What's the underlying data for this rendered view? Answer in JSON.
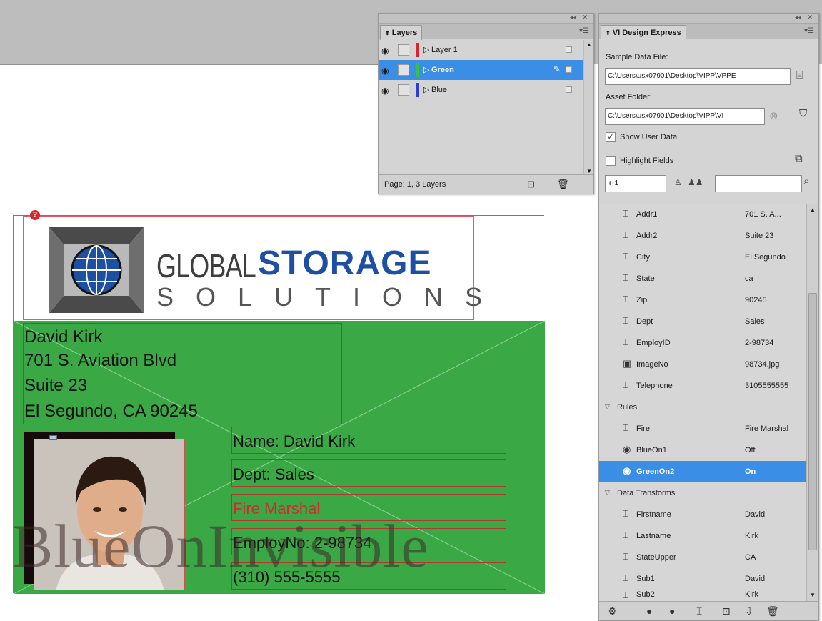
{
  "layers_panel": {
    "tab_label": "Layers",
    "layers": [
      {
        "name": "Layer 1",
        "color": "#d8262e",
        "selected": false
      },
      {
        "name": "Green",
        "color": "#35c24a",
        "selected": true
      },
      {
        "name": "Blue",
        "color": "#2b3fd6",
        "selected": false
      }
    ],
    "status": "Page: 1, 3 Layers"
  },
  "vi_panel": {
    "tab_label": "VI Design Express",
    "sample_data_label": "Sample Data File:",
    "sample_data_value": "C:\\Users\\usx07901\\Desktop\\VIPP\\VPPE",
    "asset_folder_label": "Asset Folder:",
    "asset_folder_value": "C:\\Users\\usx07901\\Desktop\\VIPP\\VI",
    "show_user_data_label": "Show User Data",
    "show_user_data_checked": true,
    "highlight_fields_label": "Highlight Fields",
    "highlight_fields_checked": false,
    "record_number": "1",
    "search_value": "",
    "fields": [
      {
        "icon": "text-field-icon",
        "name": "Addr1",
        "value": "701 S. A..."
      },
      {
        "icon": "text-field-icon",
        "name": "Addr2",
        "value": "Suite 23"
      },
      {
        "icon": "text-field-icon",
        "name": "City",
        "value": "El Segundo"
      },
      {
        "icon": "text-field-icon",
        "name": "State",
        "value": "ca"
      },
      {
        "icon": "text-field-icon",
        "name": "Zip",
        "value": "90245"
      },
      {
        "icon": "text-field-icon",
        "name": "Dept",
        "value": "Sales"
      },
      {
        "icon": "text-field-icon",
        "name": "EmployID",
        "value": "2-98734"
      },
      {
        "icon": "image-field-icon",
        "name": "ImageNo",
        "value": "98734.jpg"
      },
      {
        "icon": "text-field-icon",
        "name": "Telephone",
        "value": "3105555555"
      }
    ],
    "rules_header": "Rules",
    "rules": [
      {
        "icon": "text-rule-icon",
        "name": "Fire",
        "value": "Fire Marshal",
        "selected": false
      },
      {
        "icon": "visibility-rule-icon",
        "name": "BlueOn1",
        "value": "Off",
        "selected": false
      },
      {
        "icon": "visibility-rule-icon",
        "name": "GreenOn2",
        "value": "On",
        "selected": true
      }
    ],
    "transforms_header": "Data Transforms",
    "transforms": [
      {
        "icon": "transform-icon",
        "name": "Firstname",
        "value": "David"
      },
      {
        "icon": "transform-icon",
        "name": "Lastname",
        "value": "Kirk"
      },
      {
        "icon": "transform-icon",
        "name": "StateUpper",
        "value": "CA"
      },
      {
        "icon": "transform-icon",
        "name": "Sub1",
        "value": "David"
      },
      {
        "icon": "transform-icon",
        "name": "Sub2",
        "value": "Kirk"
      }
    ]
  },
  "document": {
    "logo": {
      "part1": "GLOBAL",
      "part2": "STORAGE",
      "part3": "SOLUTIONS"
    },
    "address_lines": [
      "David Kirk",
      "701 S. Aviation Blvd",
      "Suite 23",
      "El Segundo, CA 90245"
    ],
    "name_line": "Name: David Kirk",
    "dept_line": "Dept: Sales",
    "rule_line": "Fire Marshal",
    "employ_line": "EmployNo: 2-98734",
    "phone_line": "(310) 555-5555",
    "watermark": "BlueOnInvisible"
  }
}
